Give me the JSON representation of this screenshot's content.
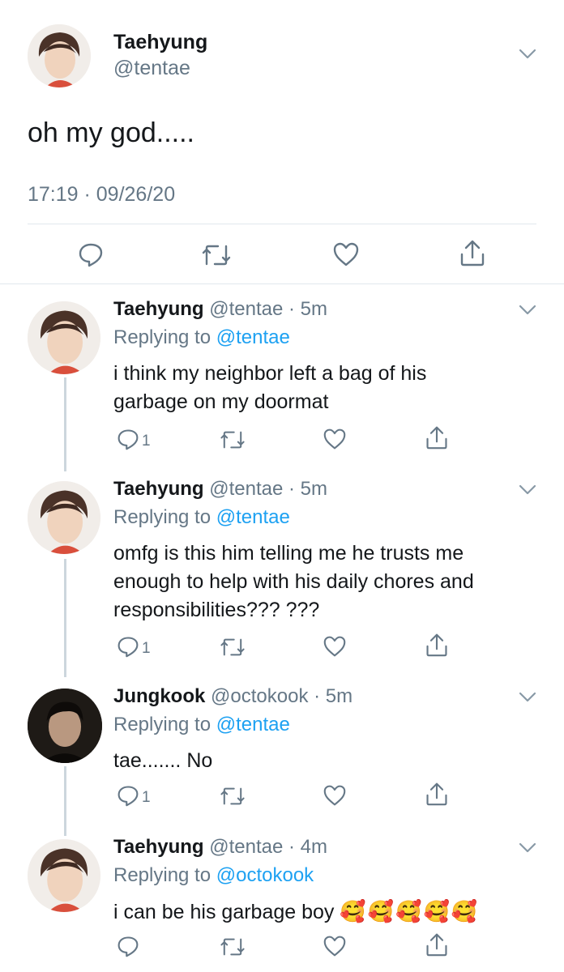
{
  "main_tweet": {
    "name": "Taehyung",
    "handle": "@tentae",
    "text": "oh my god.....",
    "timestamp": "17:19 · 09/26/20"
  },
  "replies": [
    {
      "name": "Taehyung",
      "handle": "@tentae",
      "time": "· 5m",
      "replying_prefix": "Replying to",
      "replying_to": "@tentae",
      "lines": [
        "i think my neighbor left a bag of his",
        "garbage on my doormat"
      ],
      "reply_count": "1"
    },
    {
      "name": "Taehyung",
      "handle": "@tentae",
      "time": "· 5m",
      "replying_prefix": "Replying to",
      "replying_to": "@tentae",
      "lines": [
        "omfg is this him telling me he trusts me",
        "enough to help with his daily chores and",
        "responsibilities??? ???"
      ],
      "reply_count": "1"
    },
    {
      "name": "Jungkook",
      "handle": "@octokook",
      "time": "· 5m",
      "replying_prefix": "Replying to",
      "replying_to": "@tentae",
      "lines": [
        "tae....... No"
      ],
      "reply_count": "1"
    },
    {
      "name": "Taehyung",
      "handle": "@tentae",
      "time": "· 4m",
      "replying_prefix": "Replying to",
      "replying_to": "@octokook",
      "lines": [
        "i can be his garbage boy"
      ],
      "emoji": "🥰🥰🥰🥰🥰",
      "reply_count": ""
    }
  ],
  "colors": {
    "accent": "#1da1f2",
    "secondary_text": "#657786",
    "divider": "#e1e8ed",
    "thread_line": "#ccd6dd"
  },
  "icons": [
    "reply-icon",
    "retweet-icon",
    "like-icon",
    "share-icon",
    "chevron-down-icon"
  ]
}
